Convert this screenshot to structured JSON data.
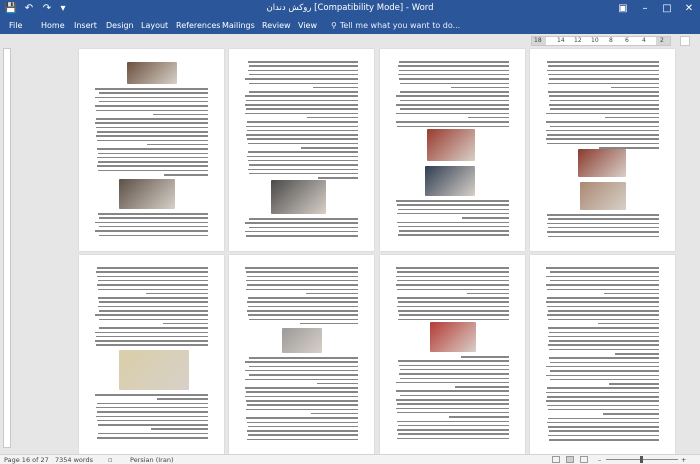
{
  "window": {
    "title": "روکش دندان [Compatibility Mode] - Word",
    "accent": "#2b579a"
  },
  "quick_access": {
    "save_icon": "save-icon",
    "undo_icon": "undo-icon",
    "redo_icon": "redo-icon",
    "customize_icon": "chevron-down-icon"
  },
  "ribbon": {
    "tabs": [
      "File",
      "Home",
      "Insert",
      "Design",
      "Layout",
      "References",
      "Mailings",
      "Review",
      "View"
    ],
    "tell_me": "Tell me what you want to do..."
  },
  "ruler": {
    "ticks": [
      "18",
      "14",
      "12",
      "10",
      "8",
      "6",
      "4",
      "2"
    ]
  },
  "status": {
    "page": "Page 16 of 27",
    "words": "7354 words",
    "language": "Persian (Iran)"
  }
}
